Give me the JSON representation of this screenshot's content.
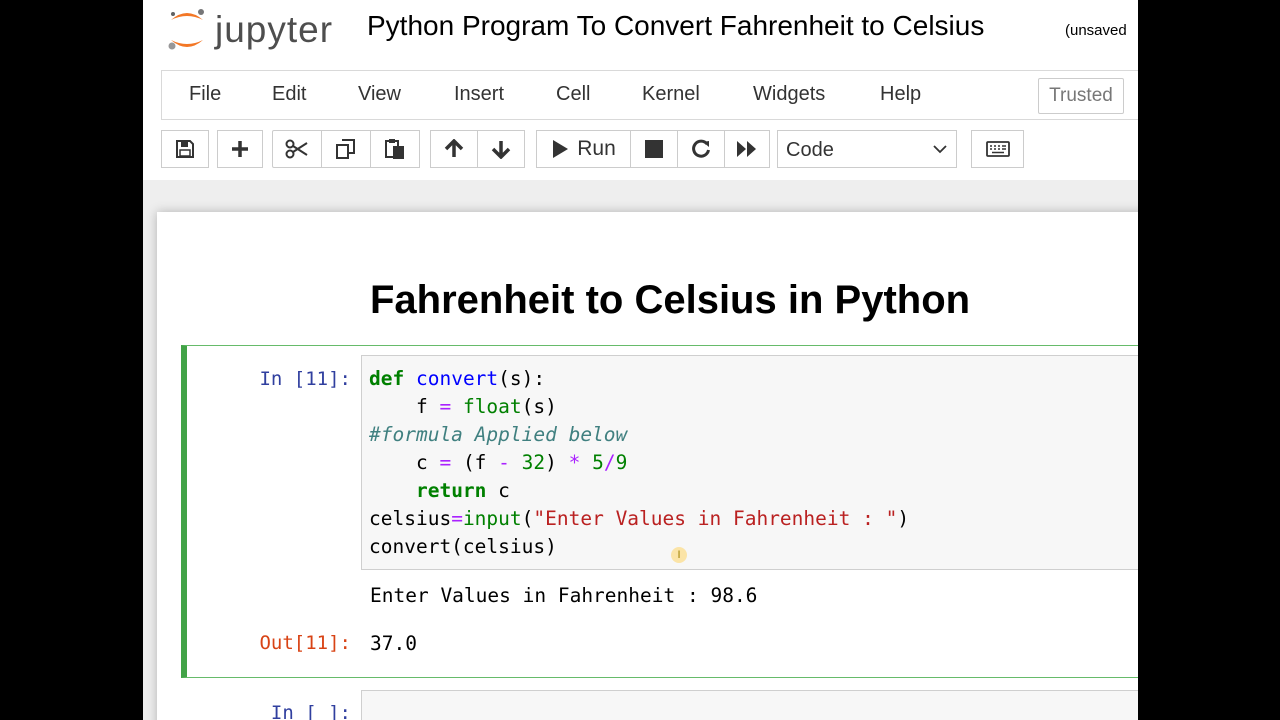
{
  "header": {
    "logo_text": "jupyter",
    "notebook_title": "Python Program To Convert Fahrenheit to Celsius",
    "save_status": "(unsaved"
  },
  "menubar": {
    "items": [
      "File",
      "Edit",
      "View",
      "Insert",
      "Cell",
      "Kernel",
      "Widgets",
      "Help"
    ],
    "trusted": "Trusted"
  },
  "toolbar": {
    "run_label": "Run",
    "cell_type": "Code",
    "icons": [
      "save-icon",
      "plus-icon",
      "cut-icon",
      "copy-icon",
      "paste-icon",
      "arrow-up-icon",
      "arrow-down-icon",
      "play-icon",
      "stop-icon",
      "restart-icon",
      "fast-forward-icon",
      "keyboard-icon"
    ]
  },
  "notebook": {
    "heading": "Fahrenheit to Celsius in Python",
    "cell1": {
      "in_prompt": "In [11]:",
      "out_prompt": "Out[11]:",
      "stdout": "Enter Values in Fahrenheit : 98.6",
      "result": "37.0"
    },
    "cell2": {
      "in_prompt": "In [ ]:"
    },
    "cursor_glyph": "I"
  },
  "colors": {
    "selected_border": "#42a347",
    "prompt_in": "#303f9f",
    "prompt_out": "#d84315",
    "logo_orange": "#f37726"
  }
}
